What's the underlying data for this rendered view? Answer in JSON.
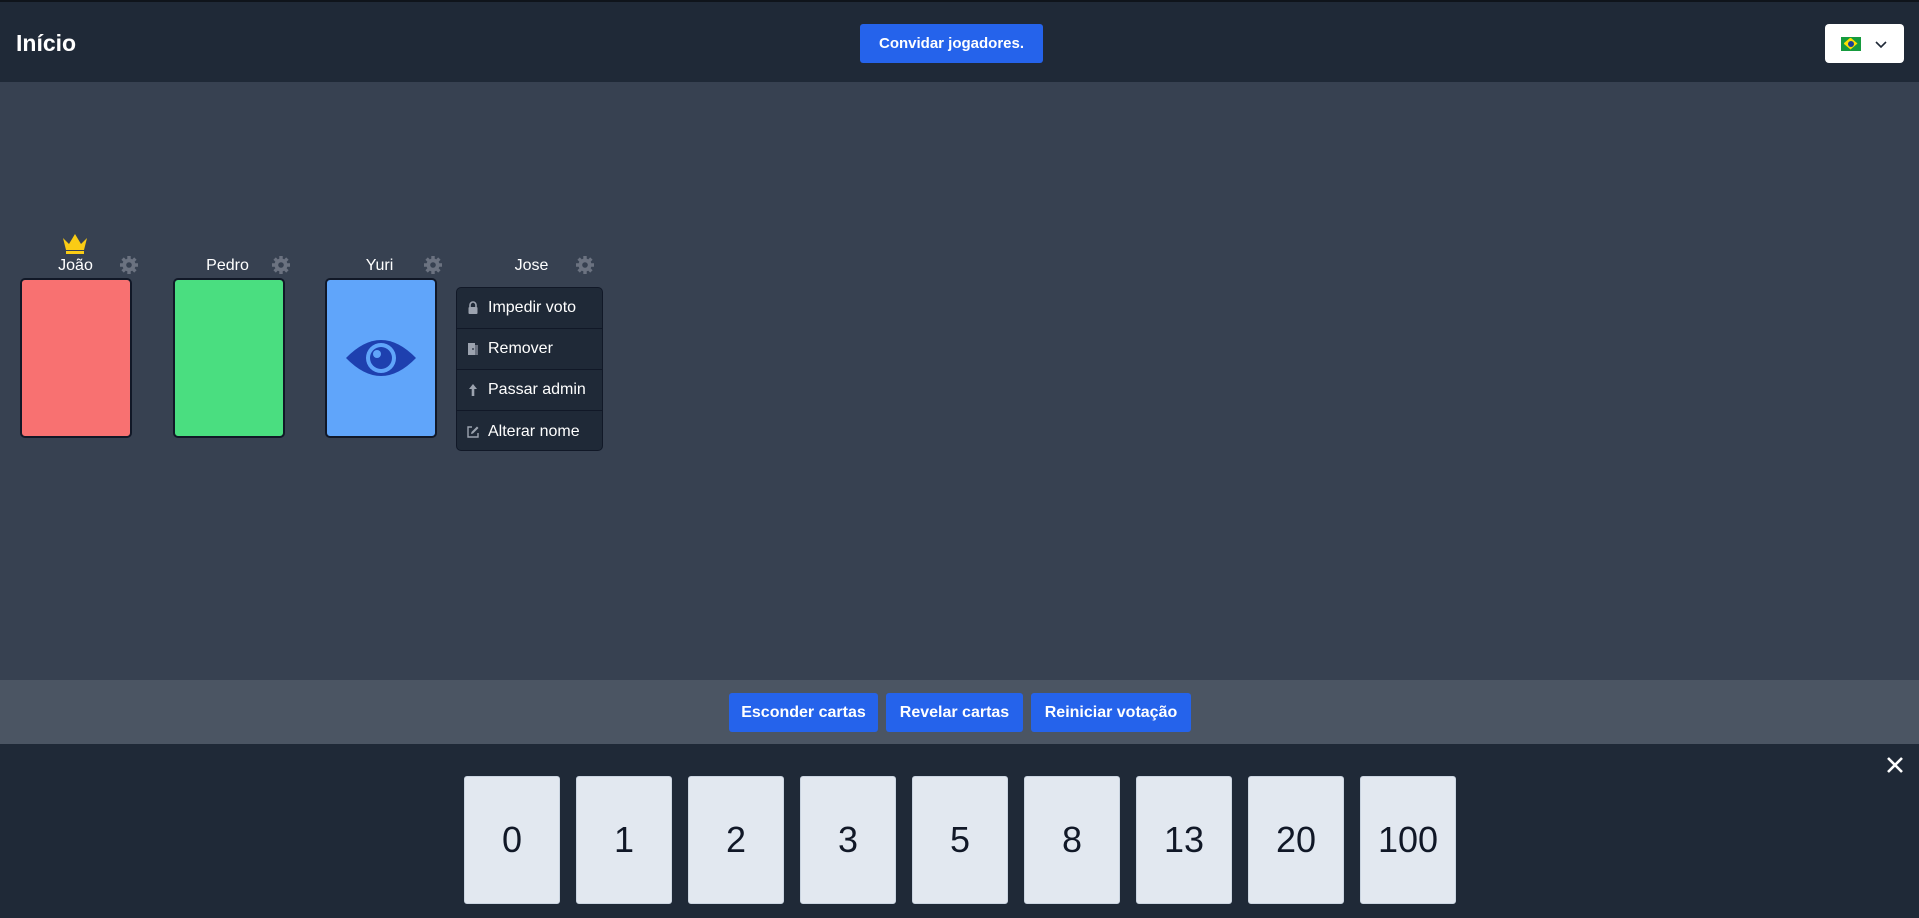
{
  "header": {
    "title": "Início",
    "invite_label": "Convidar jogadores.",
    "language": {
      "selected_icon": "brazil-flag-icon",
      "dropdown_icon": "chevron-down-icon"
    }
  },
  "players": [
    {
      "name": "João",
      "is_admin": true,
      "card_state": "voted",
      "card_color": "#f87171"
    },
    {
      "name": "Pedro",
      "is_admin": false,
      "card_state": "voted",
      "card_color": "#4ade80"
    },
    {
      "name": "Yuri",
      "is_admin": false,
      "card_state": "spectator",
      "card_color": "#60a5fa"
    },
    {
      "name": "Jose",
      "is_admin": false,
      "card_state": "menu-open"
    }
  ],
  "context_menu": {
    "items": [
      {
        "label": "Impedir voto",
        "icon": "lock-icon"
      },
      {
        "label": "Remover",
        "icon": "door-icon"
      },
      {
        "label": "Passar admin",
        "icon": "arrow-up-icon"
      },
      {
        "label": "Alterar nome",
        "icon": "edit-icon"
      }
    ]
  },
  "actions": {
    "hide_label": "Esconder cartas",
    "reveal_label": "Revelar cartas",
    "restart_label": "Reiniciar votação"
  },
  "deck": {
    "cards": [
      "0",
      "1",
      "2",
      "3",
      "5",
      "8",
      "13",
      "20",
      "100"
    ]
  },
  "colors": {
    "primary": "#2563eb",
    "header_bg": "#1f2937",
    "table_bg": "#374151",
    "admin_crown": "#facc15"
  }
}
